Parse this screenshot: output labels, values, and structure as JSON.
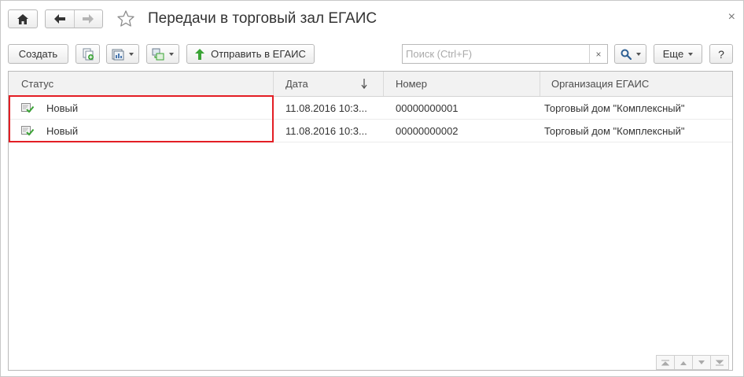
{
  "window": {
    "title": "Передачи в торговый зал ЕГАИС",
    "close_glyph": "×"
  },
  "toolbar": {
    "create_label": "Создать",
    "send_label": "Отправить в ЕГАИС",
    "more_label": "Еще",
    "help_label": "?",
    "search_placeholder": "Поиск (Ctrl+F)",
    "search_value": "",
    "clear_glyph": "×"
  },
  "table": {
    "columns": {
      "status": "Статус",
      "date": "Дата",
      "number": "Номер",
      "organization": "Организация ЕГАИС"
    },
    "sort_column": "date",
    "rows": [
      {
        "status": "Новый",
        "date": "11.08.2016 10:3...",
        "number": "00000000001",
        "organization": "Торговый дом \"Комплексный\""
      },
      {
        "status": "Новый",
        "date": "11.08.2016 10:3...",
        "number": "00000000002",
        "organization": "Торговый дом \"Комплексный\""
      }
    ]
  },
  "icons": {
    "home": "home-icon",
    "back": "arrow-left-icon",
    "forward": "arrow-right-icon",
    "favorite": "star-icon",
    "copy": "copy-add-icon",
    "report": "report-icon",
    "related": "related-docs-icon",
    "send": "arrow-up-icon",
    "search": "search-icon",
    "status": "document-check-icon"
  },
  "colors": {
    "highlight": "#e31e24",
    "send_arrow": "#3aa335",
    "status_check": "#3aa335"
  }
}
